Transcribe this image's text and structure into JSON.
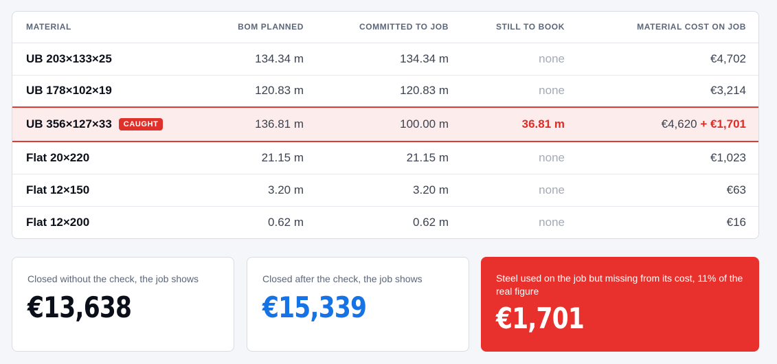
{
  "table": {
    "headers": {
      "material": "MATERIAL",
      "bom_planned": "BOM PLANNED",
      "committed": "COMMITTED TO JOB",
      "still_to_book": "STILL TO BOOK",
      "cost": "MATERIAL COST ON JOB"
    },
    "rows": [
      {
        "material": "UB 203×133×25",
        "bom_planned": "134.34 m",
        "committed": "134.34 m",
        "still_to_book": "none",
        "cost": "€4,702"
      },
      {
        "material": "UB 178×102×19",
        "bom_planned": "120.83 m",
        "committed": "120.83 m",
        "still_to_book": "none",
        "cost": "€3,214"
      },
      {
        "material": "UB 356×127×33",
        "badge": "CAUGHT",
        "bom_planned": "136.81 m",
        "committed": "100.00 m",
        "still_to_book": "36.81 m",
        "cost": "€4,620",
        "cost_extra": "+ €1,701"
      },
      {
        "material": "Flat 20×220",
        "bom_planned": "21.15 m",
        "committed": "21.15 m",
        "still_to_book": "none",
        "cost": "€1,023"
      },
      {
        "material": "Flat 12×150",
        "bom_planned": "3.20 m",
        "committed": "3.20 m",
        "still_to_book": "none",
        "cost": "€63"
      },
      {
        "material": "Flat 12×200",
        "bom_planned": "0.62 m",
        "committed": "0.62 m",
        "still_to_book": "none",
        "cost": "€16"
      }
    ]
  },
  "summary": {
    "without_check": {
      "label": "Closed without the check, the job shows",
      "value": "€13,638"
    },
    "after_check": {
      "label": "Closed after the check, the job shows",
      "value": "€15,339"
    },
    "missing": {
      "label": "Steel used on the job but missing from its cost, 11% of the real figure",
      "value": "€1,701"
    }
  },
  "colors": {
    "flag_red": "#e0302a",
    "flag_row_bg": "#fdecec",
    "accent_blue": "#1673e6",
    "muted_none": "#a3aab6"
  }
}
